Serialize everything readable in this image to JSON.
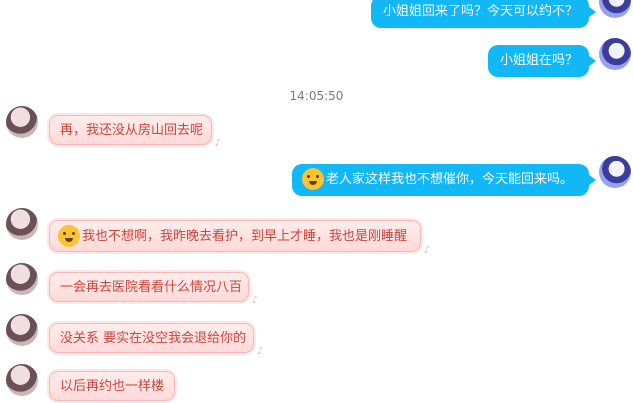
{
  "chat": {
    "timestamp": "14:05:50",
    "messages": [
      {
        "side": "right",
        "text": "小姐姐回来了吗？今天可以约不？"
      },
      {
        "side": "right",
        "text": "小姐姐在吗？"
      },
      {
        "side": "left",
        "text": "再，我还没从房山回去呢"
      },
      {
        "side": "right",
        "emoji": "crying-laugh-emoji",
        "text": "老人家这样我也不想催你，今天能回来吗。"
      },
      {
        "side": "left",
        "emoji": "crying-emoji",
        "text": "我也不想啊，我昨晚去看护，到早上才睡，我也是刚睡醒"
      },
      {
        "side": "left",
        "text": "一会再去医院看看什么情况八百"
      },
      {
        "side": "left",
        "text": "没关系 要实在没空我会退给你的"
      },
      {
        "side": "left",
        "text": "以后再约也一样楼"
      }
    ]
  },
  "colors": {
    "outgoing_bubble": "#12b7f5",
    "incoming_text": "#c8473c",
    "incoming_bg": "#ffe3e3"
  }
}
